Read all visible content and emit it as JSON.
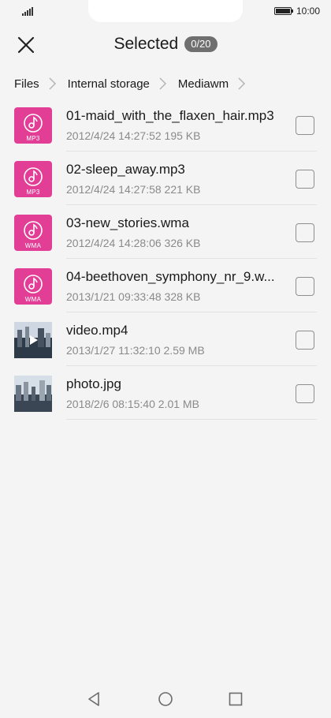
{
  "status_bar": {
    "time": "10:00"
  },
  "header": {
    "title": "Selected",
    "count": "0/20"
  },
  "breadcrumb": [
    "Files",
    "Internal storage",
    "Mediawm"
  ],
  "files": [
    {
      "name": "01-maid_with_the_flaxen_hair.mp3",
      "meta": "2012/4/24 14:27:52 195 KB",
      "type": "audio",
      "format": "MP3"
    },
    {
      "name": "02-sleep_away.mp3",
      "meta": "2012/4/24 14:27:58 221 KB",
      "type": "audio",
      "format": "MP3"
    },
    {
      "name": "03-new_stories.wma",
      "meta": "2012/4/24 14:28:06 326 KB",
      "type": "audio",
      "format": "WMA"
    },
    {
      "name": "04-beethoven_symphony_nr_9.w...",
      "meta": "2013/1/21 09:33:48 328 KB",
      "type": "audio",
      "format": "WMA"
    },
    {
      "name": "video.mp4",
      "meta": "2013/1/27 11:32:10 2.59 MB",
      "type": "video",
      "format": ""
    },
    {
      "name": "photo.jpg",
      "meta": "2018/2/6 08:15:40 2.01 MB",
      "type": "image",
      "format": ""
    }
  ],
  "colors": {
    "audio_tile": "#e23e96",
    "badge": "#6f6f6f"
  },
  "icons": {
    "close": "close-icon",
    "back": "back-triangle-icon",
    "home": "home-circle-icon",
    "recents": "recents-square-icon"
  }
}
